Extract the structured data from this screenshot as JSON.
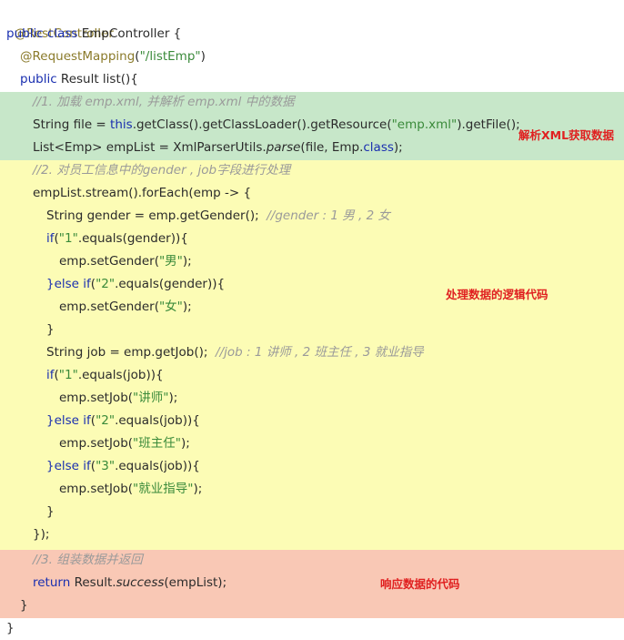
{
  "annotations": {
    "rest_controller": "@RestController",
    "request_mapping": "@RequestMapping",
    "request_mapping_arg": "\"/listEmp\""
  },
  "code": {
    "class_decl_kw": "public class ",
    "class_name": "EmpController {",
    "request_mapping_suffix": ")",
    "request_mapping_open": "(",
    "method_kw": "public ",
    "method_rest": "Result list(){",
    "comment1": "//1. 加载 emp.xml, 并解析 emp.xml 中的数据",
    "file_decl_a": "String file = ",
    "file_this": "this",
    "file_decl_b": ".getClass().getClassLoader().getResource(",
    "file_arg": "\"emp.xml\"",
    "file_decl_c": ").getFile();",
    "list_decl_a": "List<Emp> empList = XmlParserUtils.",
    "list_parse": "parse",
    "list_decl_b": "(file, Emp.",
    "list_class_kw": "class",
    "list_decl_c": ");",
    "comment2": "//2. 对员工信息中的gender , job字段进行处理",
    "stream_line": "empList.stream().forEach(emp -> {",
    "gender_decl": "String gender = emp.getGender();  ",
    "gender_comment": "//gender : 1 男 , 2 女",
    "if_kw": "if",
    "gender_if_str1": "\"1\"",
    "gender_if_rest": ".equals(gender)){",
    "set_gender_a": "emp.setGender(",
    "gender_male": "\"男\"",
    "close_paren_semi": ");",
    "else_kw": "}else if",
    "gender_if_str2": "\"2\"",
    "gender_female": "\"女\"",
    "brace_close": "}",
    "job_decl": "String job = emp.getJob();  ",
    "job_comment": "//job : 1 讲师 , 2 班主任 , 3 就业指导",
    "job_if_rest": ".equals(job)){",
    "set_job_a": "emp.setJob(",
    "job1": "\"讲师\"",
    "job2": "\"班主任\"",
    "job_if_str3": "\"3\"",
    "job3": "\"就业指导\"",
    "stream_close": "});",
    "comment3": "//3. 组装数据并返回",
    "return_kw": "return ",
    "return_a": "Result.",
    "return_success": "success",
    "return_b": "(empList);",
    "method_close": "}",
    "class_close": "}",
    "open_paren": "("
  },
  "labels": {
    "parse_xml": "解析XML获取数据",
    "logic": "处理数据的逻辑代码",
    "response": "响应数据的代码"
  },
  "colors": {
    "green_band": "#c7e7c9",
    "yellow_band": "#fcfcb5",
    "red_band": "#f9c8b5",
    "label_red": "#e02020"
  }
}
